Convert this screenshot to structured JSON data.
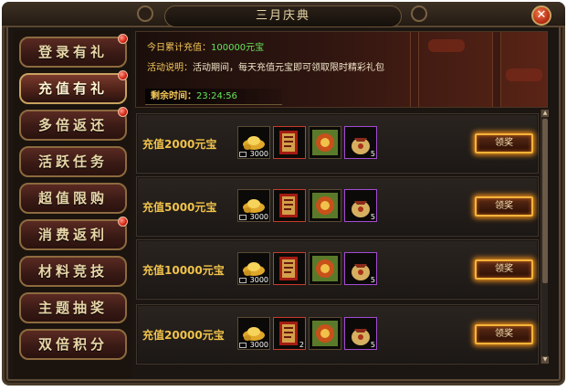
{
  "window": {
    "title": "三月庆典",
    "close_symbol": "✕"
  },
  "menu": {
    "items": [
      {
        "label": "登录有礼",
        "badge": true,
        "active": false
      },
      {
        "label": "充值有礼",
        "badge": true,
        "active": true
      },
      {
        "label": "多倍返还",
        "badge": true,
        "active": false
      },
      {
        "label": "活跃任务",
        "badge": false,
        "active": false
      },
      {
        "label": "超值限购",
        "badge": false,
        "active": false
      },
      {
        "label": "消费返利",
        "badge": true,
        "active": false
      },
      {
        "label": "材料竞技",
        "badge": false,
        "active": false
      },
      {
        "label": "主题抽奖",
        "badge": false,
        "active": false
      },
      {
        "label": "双倍积分",
        "badge": false,
        "active": false
      }
    ]
  },
  "info": {
    "total_label": "今日累计充值：",
    "total_value": "100000元宝",
    "desc_label": "活动说明：",
    "desc_text": "活动期间，每天充值元宝即可领取限时精彩礼包",
    "timer_label": "剩余时间：",
    "timer_value": "23:24:56"
  },
  "rewards": [
    {
      "title": "充值2000元宝",
      "button": "领奖",
      "items": [
        {
          "icon": "gold-ingot-icon",
          "qty": "3000",
          "frame": "plain"
        },
        {
          "icon": "red-scroll-icon",
          "qty": "",
          "frame": "red"
        },
        {
          "icon": "gem-box-icon",
          "qty": "",
          "frame": "plain"
        },
        {
          "icon": "gift-pouch-icon",
          "qty": "5",
          "frame": "purple"
        }
      ]
    },
    {
      "title": "充值5000元宝",
      "button": "领奖",
      "items": [
        {
          "icon": "gold-ingot-icon",
          "qty": "3000",
          "frame": "plain"
        },
        {
          "icon": "red-scroll-icon",
          "qty": "",
          "frame": "red"
        },
        {
          "icon": "gem-box-icon",
          "qty": "",
          "frame": "plain"
        },
        {
          "icon": "gift-pouch-icon",
          "qty": "5",
          "frame": "purple"
        }
      ]
    },
    {
      "title": "充值10000元宝",
      "button": "领奖",
      "items": [
        {
          "icon": "gold-ingot-icon",
          "qty": "3000",
          "frame": "plain"
        },
        {
          "icon": "red-scroll-icon",
          "qty": "",
          "frame": "red"
        },
        {
          "icon": "gem-box-icon",
          "qty": "",
          "frame": "plain"
        },
        {
          "icon": "gift-pouch-icon",
          "qty": "5",
          "frame": "purple"
        }
      ]
    },
    {
      "title": "充值20000元宝",
      "button": "领奖",
      "items": [
        {
          "icon": "gold-ingot-icon",
          "qty": "3000",
          "frame": "plain"
        },
        {
          "icon": "red-scroll-icon",
          "qty": "2",
          "frame": "red"
        },
        {
          "icon": "gem-box-icon",
          "qty": "",
          "frame": "plain"
        },
        {
          "icon": "gift-pouch-icon",
          "qty": "5",
          "frame": "purple"
        }
      ]
    }
  ],
  "colors": {
    "gold_text": "#f0c24a",
    "green_value": "#67e35b",
    "button_glow": "#e88a1a"
  }
}
